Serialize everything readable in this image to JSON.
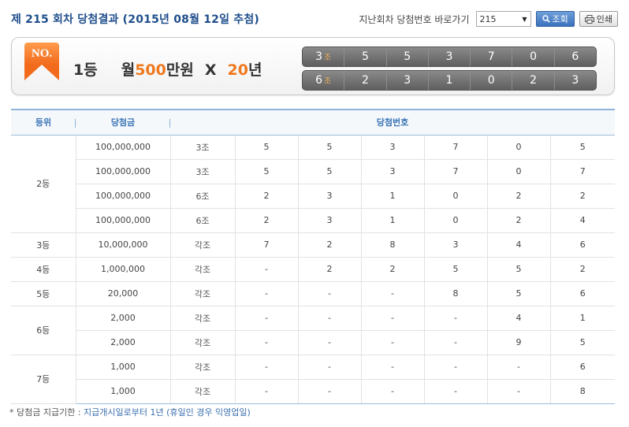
{
  "header": {
    "title": "제 215 회차 당첨결과 (2015년 08월 12일 추첨)",
    "nav_label": "지난회차 당첨번호 바로가기",
    "round_selected": "215",
    "search_button": "조회",
    "print_button": "인쇄"
  },
  "first_prize": {
    "badge": "NO.",
    "rank": "1등",
    "prize_month": "월",
    "prize_amount": "500",
    "prize_unit": "만원",
    "prize_x": "X",
    "prize_years": "20",
    "prize_year_unit": "년",
    "rows": [
      {
        "jo": "3",
        "jo_unit": "조",
        "digits": [
          "5",
          "5",
          "3",
          "7",
          "0",
          "6"
        ]
      },
      {
        "jo": "6",
        "jo_unit": "조",
        "digits": [
          "2",
          "3",
          "1",
          "0",
          "2",
          "3"
        ]
      }
    ]
  },
  "table": {
    "headers": {
      "rank": "등위",
      "amount": "당첨금",
      "numbers": "당첨번호"
    },
    "groups": [
      {
        "rank": "2등",
        "rows": [
          {
            "amount": "100,000,000",
            "jo": "3조",
            "digits": [
              "5",
              "5",
              "3",
              "7",
              "0",
              "5"
            ]
          },
          {
            "amount": "100,000,000",
            "jo": "3조",
            "digits": [
              "5",
              "5",
              "3",
              "7",
              "0",
              "7"
            ]
          },
          {
            "amount": "100,000,000",
            "jo": "6조",
            "digits": [
              "2",
              "3",
              "1",
              "0",
              "2",
              "2"
            ]
          },
          {
            "amount": "100,000,000",
            "jo": "6조",
            "digits": [
              "2",
              "3",
              "1",
              "0",
              "2",
              "4"
            ]
          }
        ]
      },
      {
        "rank": "3등",
        "rows": [
          {
            "amount": "10,000,000",
            "jo": "각조",
            "digits": [
              "7",
              "2",
              "8",
              "3",
              "4",
              "6"
            ]
          }
        ]
      },
      {
        "rank": "4등",
        "rows": [
          {
            "amount": "1,000,000",
            "jo": "각조",
            "digits": [
              "-",
              "2",
              "2",
              "5",
              "5",
              "2"
            ]
          }
        ]
      },
      {
        "rank": "5등",
        "rows": [
          {
            "amount": "20,000",
            "jo": "각조",
            "digits": [
              "-",
              "-",
              "-",
              "8",
              "5",
              "6"
            ]
          }
        ]
      },
      {
        "rank": "6등",
        "rows": [
          {
            "amount": "2,000",
            "jo": "각조",
            "digits": [
              "-",
              "-",
              "-",
              "-",
              "4",
              "1"
            ]
          },
          {
            "amount": "2,000",
            "jo": "각조",
            "digits": [
              "-",
              "-",
              "-",
              "-",
              "9",
              "5"
            ]
          }
        ]
      },
      {
        "rank": "7등",
        "rows": [
          {
            "amount": "1,000",
            "jo": "각조",
            "digits": [
              "-",
              "-",
              "-",
              "-",
              "-",
              "6"
            ]
          },
          {
            "amount": "1,000",
            "jo": "각조",
            "digits": [
              "-",
              "-",
              "-",
              "-",
              "-",
              "8"
            ]
          }
        ]
      }
    ]
  },
  "footnote": {
    "label": "* 당첨금 지급기한 :",
    "value": "지급개시일로부터 1년 (휴일인 경우 익영업일)"
  },
  "colors": {
    "title_blue": "#1f4e8c",
    "accent_orange": "#f0791e",
    "header_blue": "#3a74b6"
  }
}
